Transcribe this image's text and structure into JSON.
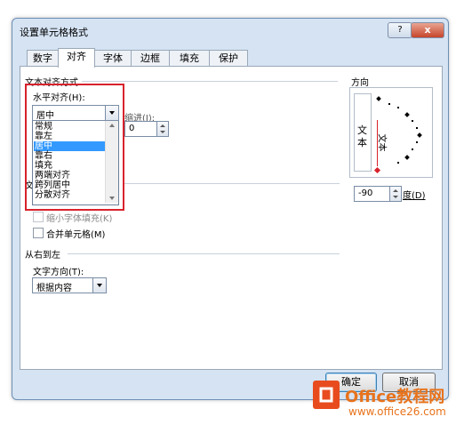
{
  "window": {
    "title": "设置单元格格式",
    "help_label": "?",
    "close_label": "x"
  },
  "tabs": [
    {
      "label": "数字"
    },
    {
      "label": "对齐"
    },
    {
      "label": "字体"
    },
    {
      "label": "边框"
    },
    {
      "label": "填充"
    },
    {
      "label": "保护"
    }
  ],
  "alignment": {
    "section_title": "文本对齐方式",
    "horizontal_label": "水平对齐(H):",
    "horizontal_value": "居中",
    "horizontal_options": [
      "常规",
      "靠左",
      "居中",
      "靠右",
      "填充",
      "两端对齐",
      "跨列居中",
      "分散对齐"
    ],
    "indent_label": "缩进(I):",
    "indent_value": "0"
  },
  "text_control": {
    "section_title_partial": "文",
    "shrink_label": "缩小字体填充(K)",
    "merge_label": "合并单元格(M)"
  },
  "rtl": {
    "section_title": "从右到左",
    "direction_label": "文字方向(T):",
    "direction_value": "根据内容"
  },
  "orientation": {
    "section_title": "方向",
    "vertical_text": "文\n本",
    "rotated_text": "文本",
    "degree_value": "-90",
    "degree_label": "度(D)"
  },
  "buttons": {
    "ok": "确定",
    "cancel": "取消"
  },
  "watermark": {
    "brand": "Office教程网",
    "url": "www.office26.com"
  },
  "colors": {
    "highlight_border": "#d8222c",
    "selection": "#3399ff",
    "watermark": "#e8731c"
  }
}
